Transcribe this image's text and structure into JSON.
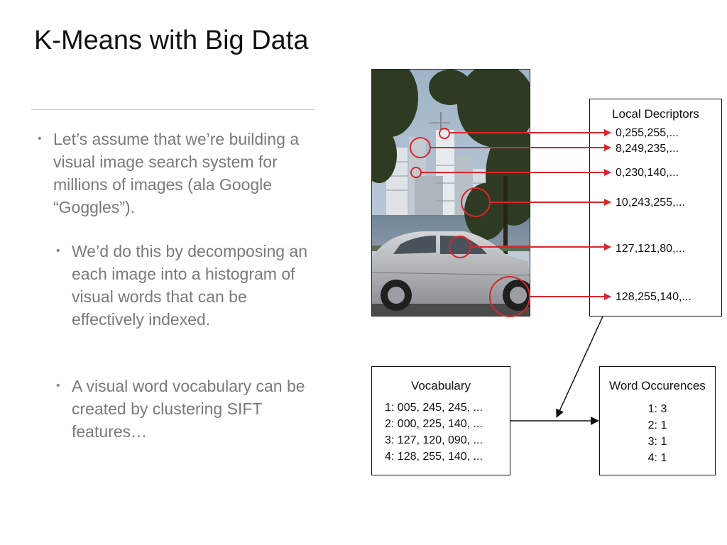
{
  "slide": {
    "title": "K-Means with Big Data",
    "bullets": [
      "Let’s assume that we’re building a visual image search system for millions of images (ala Google “Goggles”).",
      "We’d do this by decomposing an each image into a histogram of visual words that can be effectively indexed.",
      "A visual word vocabulary can be created by clustering SIFT features…"
    ]
  },
  "diagram": {
    "local_descriptors": {
      "title": "Local Decriptors",
      "values": [
        "0,255,255,...",
        "8,249,235,...",
        "0,230,140,...",
        "10,243,255,...",
        "127,121,80,...",
        "128,255,140,..."
      ]
    },
    "vocabulary": {
      "title": "Vocabulary",
      "entries": [
        "1: 005, 245, 245, ...",
        "2: 000, 225, 140, ...",
        "3: 127, 120, 090, ...",
        "4: 128, 255, 140, ..."
      ]
    },
    "word_occurrences": {
      "title": "Word Occurences",
      "entries": [
        "1: 3",
        "2: 1",
        "3: 1",
        "4: 1"
      ]
    },
    "colors": {
      "arrow_red": "#d9262c",
      "arrow_black": "#111111"
    }
  }
}
